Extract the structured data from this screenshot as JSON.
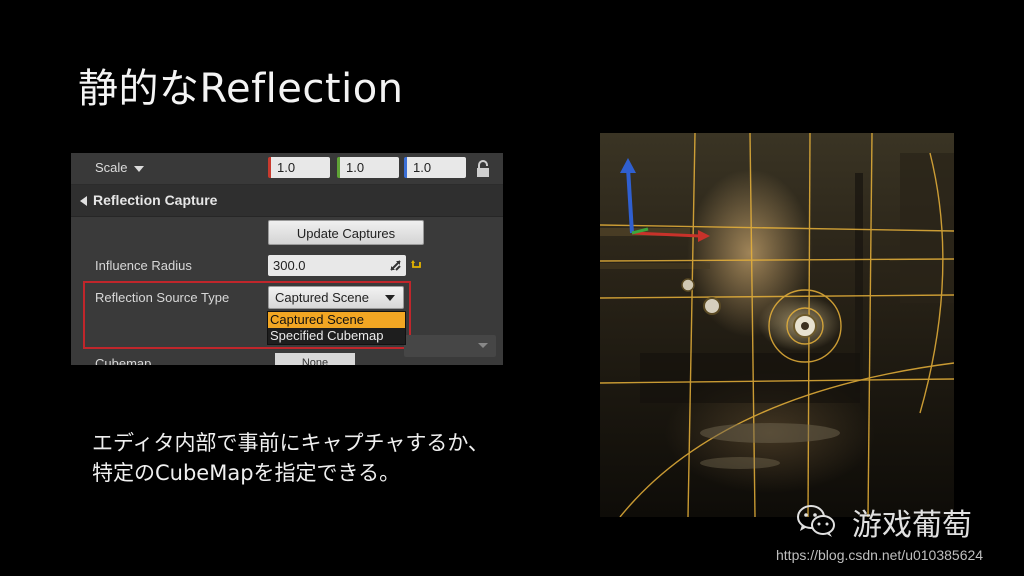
{
  "slide": {
    "title": "静的なReflection",
    "description_line1": "エディタ内部で事前にキャプチャするか、",
    "description_line2": "特定のCubeMapを指定できる。"
  },
  "details_panel": {
    "scale_label": "Scale",
    "scale_x": "1.0",
    "scale_y": "1.0",
    "scale_z": "1.0",
    "section_title": "Reflection Capture",
    "update_button": "Update Captures",
    "influence_radius_label": "Influence Radius",
    "influence_radius_value": "300.0",
    "source_type_label": "Reflection Source Type",
    "source_type_value": "Captured Scene",
    "source_type_options": [
      "Captured Scene",
      "Specified Cubemap"
    ],
    "selected_option_index": 0,
    "cubemap_label": "Cubemap",
    "cubemap_value": "None",
    "highlight_color": "#c0262b",
    "selected_color": "#f2a623"
  },
  "watermark": {
    "brand": "游戏葡萄",
    "url": "https://blog.csdn.net/u010385624"
  }
}
